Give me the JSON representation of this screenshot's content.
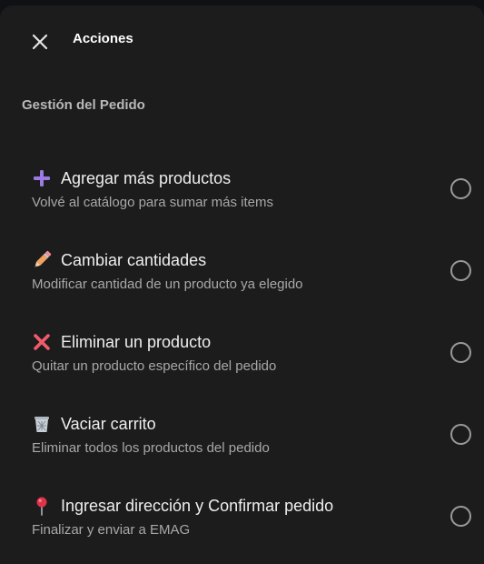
{
  "header": {
    "title": "Acciones",
    "close_icon": "close-icon"
  },
  "section": {
    "title": "Gestión del Pedido"
  },
  "options": [
    {
      "icon": "plus-icon",
      "icon_color": "#9b7be3",
      "label": "Agregar más productos",
      "description": "Volvé al catálogo para sumar más items",
      "selected": false
    },
    {
      "icon": "pencil-icon",
      "icon_color": "#f0a060",
      "label": "Cambiar cantidades",
      "description": "Modificar cantidad de un producto ya elegido",
      "selected": false
    },
    {
      "icon": "cross-mark-icon",
      "icon_color": "#f15b6c",
      "label": "Eliminar un producto",
      "description": "Quitar un producto específico del pedido",
      "selected": false
    },
    {
      "icon": "wastebasket-icon",
      "icon_color": "#c9cfd6",
      "label": "Vaciar carrito",
      "description": "Eliminar todos los productos del pedido",
      "selected": false
    },
    {
      "icon": "round-pushpin-icon",
      "icon_color": "#e0334a",
      "label": "Ingresar dirección y Confirmar pedido",
      "description": "Finalizar y enviar a EMAG",
      "selected": false
    }
  ]
}
